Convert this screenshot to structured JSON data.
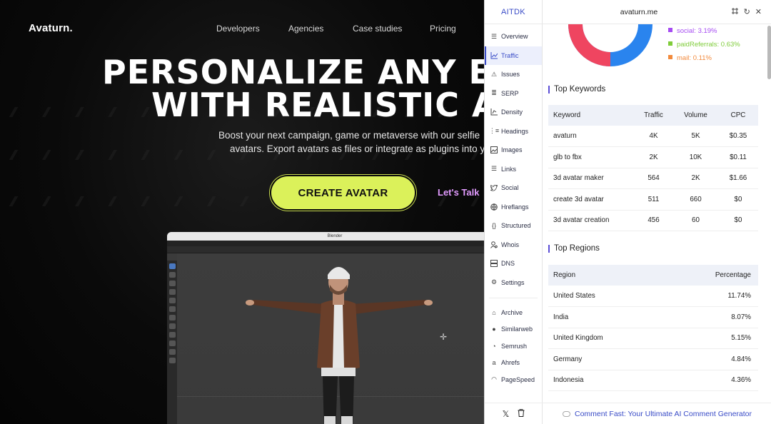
{
  "site": {
    "logo": "Avaturn.",
    "nav": [
      "Developers",
      "Agencies",
      "Case studies",
      "Pricing"
    ],
    "hero_line1": "PERSONALIZE ANY EX",
    "hero_line2": "WITH REALISTIC AV",
    "sub_line1": "Boost your next campaign, game or metaverse with our selfie",
    "sub_line2": "avatars. Export avatars as files or integrate as plugins into yo",
    "cta": "CREATE AVATAR",
    "lets_talk": "Let's Talk",
    "blender_title": "Blender"
  },
  "ext": {
    "brand": "AITDK",
    "domain": "avaturn.me",
    "nav": [
      {
        "label": "Overview",
        "icon": "list-icon"
      },
      {
        "label": "Traffic",
        "icon": "chart-icon"
      },
      {
        "label": "Issues",
        "icon": "warning-icon"
      },
      {
        "label": "SERP",
        "icon": "serp-icon"
      },
      {
        "label": "Density",
        "icon": "density-icon"
      },
      {
        "label": "Headings",
        "icon": "headings-icon"
      },
      {
        "label": "Images",
        "icon": "image-icon"
      },
      {
        "label": "Links",
        "icon": "links-icon"
      },
      {
        "label": "Social",
        "icon": "twitter-icon"
      },
      {
        "label": "Hreflangs",
        "icon": "globe-icon"
      },
      {
        "label": "Structured",
        "icon": "braces-icon"
      },
      {
        "label": "Whois",
        "icon": "person-icon"
      },
      {
        "label": "DNS",
        "icon": "server-icon"
      },
      {
        "label": "Settings",
        "icon": "gear-icon"
      }
    ],
    "external": [
      {
        "label": "Archive",
        "icon": "archive-icon"
      },
      {
        "label": "Similarweb",
        "icon": "similarweb-icon"
      },
      {
        "label": "Semrush",
        "icon": "semrush-icon"
      },
      {
        "label": "Ahrefs",
        "icon": "ahrefs-icon"
      },
      {
        "label": "PageSpeed",
        "icon": "speed-icon"
      }
    ],
    "legend": [
      {
        "label": "social: 3.19%",
        "color": "#a64cf2"
      },
      {
        "label": "paidReferrals: 0.63%",
        "color": "#7fcc3a"
      },
      {
        "label": "mail: 0.11%",
        "color": "#f28a3c"
      }
    ],
    "donut_colors": {
      "direct": "#2a84ee",
      "search": "#ef4560"
    },
    "keywords_title": "Top Keywords",
    "keywords_headers": [
      "Keyword",
      "Traffic",
      "Volume",
      "CPC"
    ],
    "keywords": [
      [
        "avaturn",
        "4K",
        "5K",
        "$0.35"
      ],
      [
        "glb to fbx",
        "2K",
        "10K",
        "$0.11"
      ],
      [
        "3d avatar maker",
        "564",
        "2K",
        "$1.66"
      ],
      [
        "create 3d avatar",
        "511",
        "660",
        "$0"
      ],
      [
        "3d avatar creation",
        "456",
        "60",
        "$0"
      ]
    ],
    "regions_title": "Top Regions",
    "regions_headers": [
      "Region",
      "Percentage"
    ],
    "regions": [
      [
        "United States",
        "11.74%"
      ],
      [
        "India",
        "8.07%"
      ],
      [
        "United Kingdom",
        "5.15%"
      ],
      [
        "Germany",
        "4.84%"
      ],
      [
        "Indonesia",
        "4.36%"
      ]
    ],
    "promo": "Comment Fast: Your Ultimate AI Comment Generator"
  }
}
